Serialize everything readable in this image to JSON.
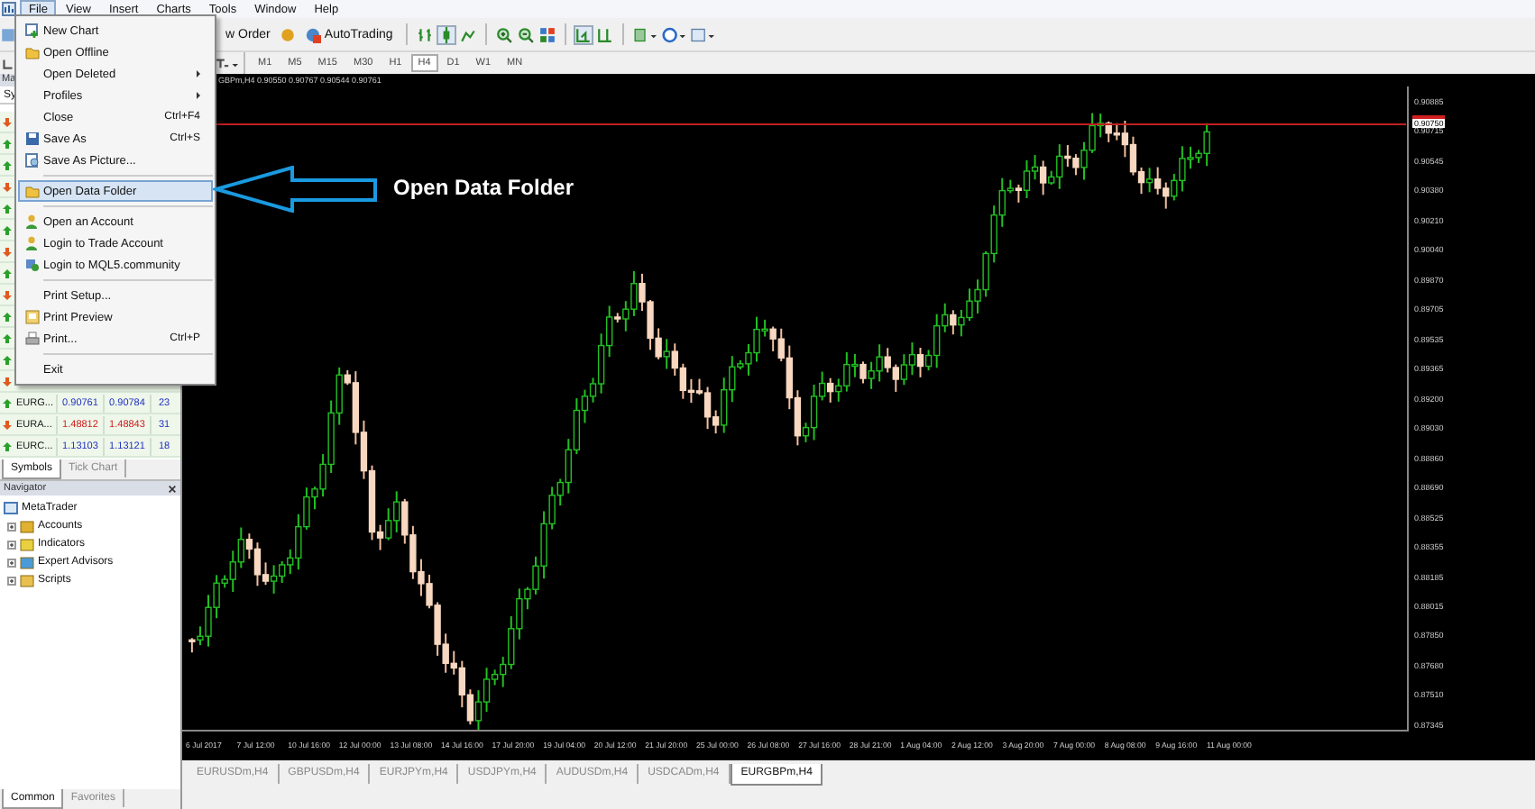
{
  "menubar": {
    "items": [
      {
        "label": "File",
        "selected": true
      },
      {
        "label": "View",
        "selected": false
      },
      {
        "label": "Insert",
        "selected": false
      },
      {
        "label": "Charts",
        "selected": false
      },
      {
        "label": "Tools",
        "selected": false
      },
      {
        "label": "Window",
        "selected": false
      },
      {
        "label": "Help",
        "selected": false
      }
    ]
  },
  "file_menu": {
    "items": [
      {
        "kind": "item",
        "label": "New Chart",
        "selected": false
      },
      {
        "kind": "item",
        "label": "Open Offline",
        "selected": false
      },
      {
        "kind": "item",
        "label": "Open Deleted",
        "submenu": true,
        "selected": false
      },
      {
        "kind": "item",
        "label": "Profiles",
        "submenu": true,
        "selected": false
      },
      {
        "kind": "item",
        "label": "Close",
        "shortcut": "Ctrl+F4",
        "selected": false
      },
      {
        "kind": "item",
        "label": "Save As",
        "shortcut": "Ctrl+S",
        "selected": false
      },
      {
        "kind": "item",
        "label": "Save As Picture...",
        "selected": false
      },
      {
        "kind": "separator"
      },
      {
        "kind": "item",
        "label": "Open Data Folder",
        "selected": true
      },
      {
        "kind": "separator"
      },
      {
        "kind": "item",
        "label": "Open an Account",
        "selected": false
      },
      {
        "kind": "item",
        "label": "Login to Trade Account",
        "selected": false
      },
      {
        "kind": "item",
        "label": "Login to MQL5.community",
        "selected": false
      },
      {
        "kind": "separator"
      },
      {
        "kind": "item",
        "label": "Print Setup...",
        "selected": false
      },
      {
        "kind": "item",
        "label": "Print Preview",
        "selected": false
      },
      {
        "kind": "item",
        "label": "Print...",
        "shortcut": "Ctrl+P",
        "selected": false
      },
      {
        "kind": "separator"
      },
      {
        "kind": "item",
        "label": "Exit",
        "selected": false
      }
    ]
  },
  "toolbar": {
    "new_order": "w Order",
    "autotrading": "AutoTrading",
    "timeframes": [
      {
        "label": "M1",
        "selected": false
      },
      {
        "label": "M5",
        "selected": false
      },
      {
        "label": "M15",
        "selected": false
      },
      {
        "label": "M30",
        "selected": false
      },
      {
        "label": "H1",
        "selected": false
      },
      {
        "label": "H4",
        "selected": true
      },
      {
        "label": "D1",
        "selected": false
      },
      {
        "label": "W1",
        "selected": false
      },
      {
        "label": "MN",
        "selected": false
      }
    ]
  },
  "market_watch": {
    "title": "Ma",
    "columns": [
      "Sy"
    ],
    "rows": [
      {
        "kind": "covered",
        "rising": false
      },
      {
        "kind": "covered",
        "rising": true
      },
      {
        "kind": "covered",
        "rising": true
      },
      {
        "kind": "covered",
        "rising": false
      },
      {
        "kind": "covered",
        "rising": true
      },
      {
        "kind": "covered",
        "rising": true
      },
      {
        "kind": "covered",
        "rising": false
      },
      {
        "kind": "covered",
        "rising": true
      },
      {
        "kind": "covered",
        "rising": false
      },
      {
        "kind": "covered",
        "rising": true
      },
      {
        "kind": "covered",
        "rising": true
      },
      {
        "kind": "covered",
        "rising": true
      },
      {
        "kind": "covered",
        "rising": false
      },
      {
        "kind": "quote",
        "rising": true,
        "symbol": "EURG...",
        "bid": "0.90761",
        "ask": "0.90784",
        "spread": "23"
      },
      {
        "kind": "quote",
        "rising": false,
        "symbol": "EURA...",
        "bid": "1.48812",
        "ask": "1.48843",
        "spread": "31"
      },
      {
        "kind": "quote",
        "rising": true,
        "symbol": "EURC...",
        "bid": "1.13103",
        "ask": "1.13121",
        "spread": "18"
      }
    ],
    "tabs": [
      {
        "label": "Symbols",
        "selected": true
      },
      {
        "label": "Tick Chart",
        "selected": false
      }
    ]
  },
  "navigator": {
    "title": "Navigator",
    "tree": [
      {
        "label": "MetaTrader",
        "children": [
          {
            "label": "Accounts",
            "expanded": false
          },
          {
            "label": "Indicators",
            "expanded": false
          },
          {
            "label": "Expert Advisors",
            "expanded": false
          },
          {
            "label": "Scripts",
            "expanded": false
          }
        ]
      }
    ],
    "tabs": [
      {
        "label": "Common",
        "selected": true
      },
      {
        "label": "Favorites",
        "selected": false
      }
    ]
  },
  "chart": {
    "info": "GBPm,H4 0.90550 0.90767 0.90544 0.90761",
    "current_price": "0.90750",
    "price_labels": [
      "0.90885",
      "0.90715",
      "0.90545",
      "0.90380",
      "0.90210",
      "0.90040",
      "0.89870",
      "0.89705",
      "0.89535",
      "0.89365",
      "0.89200",
      "0.89030",
      "0.88860",
      "0.88690",
      "0.88525",
      "0.88355",
      "0.88185",
      "0.88015",
      "0.87850",
      "0.87680",
      "0.87510",
      "0.87345"
    ],
    "time_labels": [
      "6 Jul 2017",
      "7 Jul 12:00",
      "10 Jul 16:00",
      "12 Jul 00:00",
      "13 Jul 08:00",
      "14 Jul 16:00",
      "17 Jul 20:00",
      "19 Jul 04:00",
      "20 Jul 12:00",
      "21 Jul 20:00",
      "25 Jul 00:00",
      "26 Jul 08:00",
      "27 Jul 16:00",
      "28 Jul 21:00",
      "1 Aug 04:00",
      "2 Aug 12:00",
      "3 Aug 20:00",
      "7 Aug 00:00",
      "8 Aug 08:00",
      "9 Aug 16:00",
      "11 Aug 00:00"
    ],
    "callout": "Open Data Folder"
  },
  "chart_tabs": [
    {
      "label": "EURUSDm,H4",
      "selected": false
    },
    {
      "label": "GBPUSDm,H4",
      "selected": false
    },
    {
      "label": "EURJPYm,H4",
      "selected": false
    },
    {
      "label": "USDJPYm,H4",
      "selected": false
    },
    {
      "label": "AUDUSDm,H4",
      "selected": false
    },
    {
      "label": "USDCADm,H4",
      "selected": false
    },
    {
      "label": "EURGBPm,H4",
      "selected": true
    }
  ]
}
